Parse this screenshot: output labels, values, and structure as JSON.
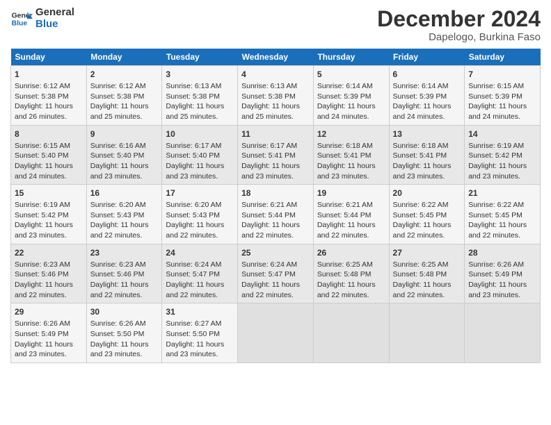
{
  "logo": {
    "line1": "General",
    "line2": "Blue"
  },
  "title": "December 2024",
  "location": "Dapelogo, Burkina Faso",
  "days_of_week": [
    "Sunday",
    "Monday",
    "Tuesday",
    "Wednesday",
    "Thursday",
    "Friday",
    "Saturday"
  ],
  "weeks": [
    [
      {
        "day": "1",
        "info": "Sunrise: 6:12 AM\nSunset: 5:38 PM\nDaylight: 11 hours\nand 26 minutes."
      },
      {
        "day": "2",
        "info": "Sunrise: 6:12 AM\nSunset: 5:38 PM\nDaylight: 11 hours\nand 25 minutes."
      },
      {
        "day": "3",
        "info": "Sunrise: 6:13 AM\nSunset: 5:38 PM\nDaylight: 11 hours\nand 25 minutes."
      },
      {
        "day": "4",
        "info": "Sunrise: 6:13 AM\nSunset: 5:38 PM\nDaylight: 11 hours\nand 25 minutes."
      },
      {
        "day": "5",
        "info": "Sunrise: 6:14 AM\nSunset: 5:39 PM\nDaylight: 11 hours\nand 24 minutes."
      },
      {
        "day": "6",
        "info": "Sunrise: 6:14 AM\nSunset: 5:39 PM\nDaylight: 11 hours\nand 24 minutes."
      },
      {
        "day": "7",
        "info": "Sunrise: 6:15 AM\nSunset: 5:39 PM\nDaylight: 11 hours\nand 24 minutes."
      }
    ],
    [
      {
        "day": "8",
        "info": "Sunrise: 6:15 AM\nSunset: 5:40 PM\nDaylight: 11 hours\nand 24 minutes."
      },
      {
        "day": "9",
        "info": "Sunrise: 6:16 AM\nSunset: 5:40 PM\nDaylight: 11 hours\nand 23 minutes."
      },
      {
        "day": "10",
        "info": "Sunrise: 6:17 AM\nSunset: 5:40 PM\nDaylight: 11 hours\nand 23 minutes."
      },
      {
        "day": "11",
        "info": "Sunrise: 6:17 AM\nSunset: 5:41 PM\nDaylight: 11 hours\nand 23 minutes."
      },
      {
        "day": "12",
        "info": "Sunrise: 6:18 AM\nSunset: 5:41 PM\nDaylight: 11 hours\nand 23 minutes."
      },
      {
        "day": "13",
        "info": "Sunrise: 6:18 AM\nSunset: 5:41 PM\nDaylight: 11 hours\nand 23 minutes."
      },
      {
        "day": "14",
        "info": "Sunrise: 6:19 AM\nSunset: 5:42 PM\nDaylight: 11 hours\nand 23 minutes."
      }
    ],
    [
      {
        "day": "15",
        "info": "Sunrise: 6:19 AM\nSunset: 5:42 PM\nDaylight: 11 hours\nand 23 minutes."
      },
      {
        "day": "16",
        "info": "Sunrise: 6:20 AM\nSunset: 5:43 PM\nDaylight: 11 hours\nand 22 minutes."
      },
      {
        "day": "17",
        "info": "Sunrise: 6:20 AM\nSunset: 5:43 PM\nDaylight: 11 hours\nand 22 minutes."
      },
      {
        "day": "18",
        "info": "Sunrise: 6:21 AM\nSunset: 5:44 PM\nDaylight: 11 hours\nand 22 minutes."
      },
      {
        "day": "19",
        "info": "Sunrise: 6:21 AM\nSunset: 5:44 PM\nDaylight: 11 hours\nand 22 minutes."
      },
      {
        "day": "20",
        "info": "Sunrise: 6:22 AM\nSunset: 5:45 PM\nDaylight: 11 hours\nand 22 minutes."
      },
      {
        "day": "21",
        "info": "Sunrise: 6:22 AM\nSunset: 5:45 PM\nDaylight: 11 hours\nand 22 minutes."
      }
    ],
    [
      {
        "day": "22",
        "info": "Sunrise: 6:23 AM\nSunset: 5:46 PM\nDaylight: 11 hours\nand 22 minutes."
      },
      {
        "day": "23",
        "info": "Sunrise: 6:23 AM\nSunset: 5:46 PM\nDaylight: 11 hours\nand 22 minutes."
      },
      {
        "day": "24",
        "info": "Sunrise: 6:24 AM\nSunset: 5:47 PM\nDaylight: 11 hours\nand 22 minutes."
      },
      {
        "day": "25",
        "info": "Sunrise: 6:24 AM\nSunset: 5:47 PM\nDaylight: 11 hours\nand 22 minutes."
      },
      {
        "day": "26",
        "info": "Sunrise: 6:25 AM\nSunset: 5:48 PM\nDaylight: 11 hours\nand 22 minutes."
      },
      {
        "day": "27",
        "info": "Sunrise: 6:25 AM\nSunset: 5:48 PM\nDaylight: 11 hours\nand 22 minutes."
      },
      {
        "day": "28",
        "info": "Sunrise: 6:26 AM\nSunset: 5:49 PM\nDaylight: 11 hours\nand 23 minutes."
      }
    ],
    [
      {
        "day": "29",
        "info": "Sunrise: 6:26 AM\nSunset: 5:49 PM\nDaylight: 11 hours\nand 23 minutes."
      },
      {
        "day": "30",
        "info": "Sunrise: 6:26 AM\nSunset: 5:50 PM\nDaylight: 11 hours\nand 23 minutes."
      },
      {
        "day": "31",
        "info": "Sunrise: 6:27 AM\nSunset: 5:50 PM\nDaylight: 11 hours\nand 23 minutes."
      },
      {
        "day": "",
        "info": ""
      },
      {
        "day": "",
        "info": ""
      },
      {
        "day": "",
        "info": ""
      },
      {
        "day": "",
        "info": ""
      }
    ]
  ]
}
